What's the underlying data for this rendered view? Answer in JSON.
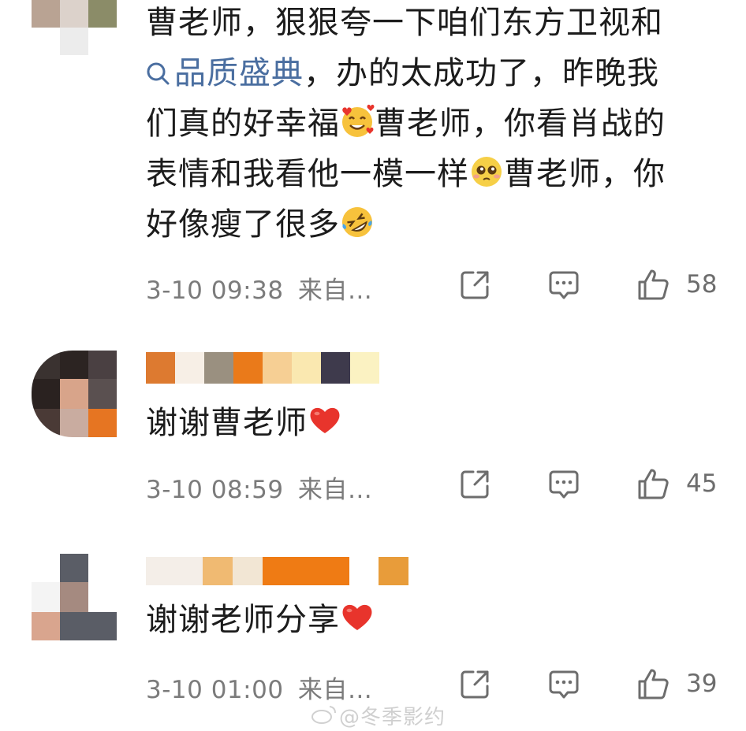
{
  "comments": [
    {
      "text_1": "曹老师，狠狠夸一下咱们东方卫视和",
      "topic": "品质盛典",
      "text_2": "，办的太成功了，昨晚我",
      "text_3": "们真的好幸福",
      "text_4": "曹老师，你看肖战的",
      "text_5": "表情和我看他一模一样",
      "text_6": "曹老师，你",
      "text_7": "好像瘦了很多",
      "time": "3-10 09:38",
      "source": "来自…",
      "likes": "58"
    },
    {
      "text": "谢谢曹老师",
      "time": "3-10 08:59",
      "source": "来自…",
      "likes": "45"
    },
    {
      "text": "谢谢老师分享",
      "time": "3-10 01:00",
      "source": "来自…",
      "likes": "39"
    }
  ],
  "icons": {
    "share": "share-icon",
    "comment": "comment-icon",
    "like": "thumbs-up-icon",
    "topic": "search-icon",
    "heart": "red-heart-emoji",
    "smile_hearts": "smiling-face-with-hearts-emoji",
    "pleading": "pleading-face-emoji",
    "rofl": "rolling-laughing-emoji"
  },
  "watermark": "@冬季影约",
  "colors": {
    "topic": "#4a6ea0",
    "meta": "#7b7b7b",
    "heart": "#e8342c"
  }
}
